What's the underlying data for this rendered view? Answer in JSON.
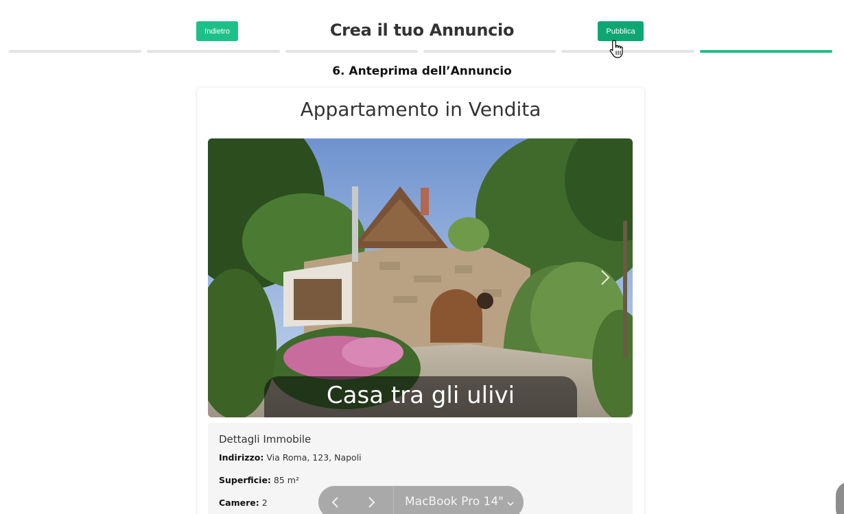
{
  "header": {
    "back_label": "Indietro",
    "title": "Crea il tuo Annuncio",
    "publish_label": "Pubblica"
  },
  "progress": {
    "total_steps": 6,
    "current_step": 6
  },
  "step_title": "6. Anteprima dell’Annuncio",
  "listing": {
    "title": "Appartamento in Vendita",
    "photo_caption": "Casa tra gli ulivi",
    "details": {
      "heading": "Dettagli Immobile",
      "address_label": "Indirizzo:",
      "address_value": "Via Roma, 123, Napoli",
      "area_label": "Superficie:",
      "area_value": "85 m²",
      "rooms_label": "Camere:",
      "rooms_value": "2"
    }
  },
  "device_toolbar": {
    "device_name": "MacBook Pro 14\""
  },
  "colors": {
    "accent": "#1ebe8a",
    "publish": "#0ea774",
    "progress_inactive": "#e3e3e3"
  },
  "icons": {
    "back": "chevron-left-icon",
    "forward": "chevron-right-icon",
    "next_photo": "chevron-right-icon",
    "device_dropdown": "chevron-down-icon",
    "cursor": "hand-pointer-icon"
  }
}
